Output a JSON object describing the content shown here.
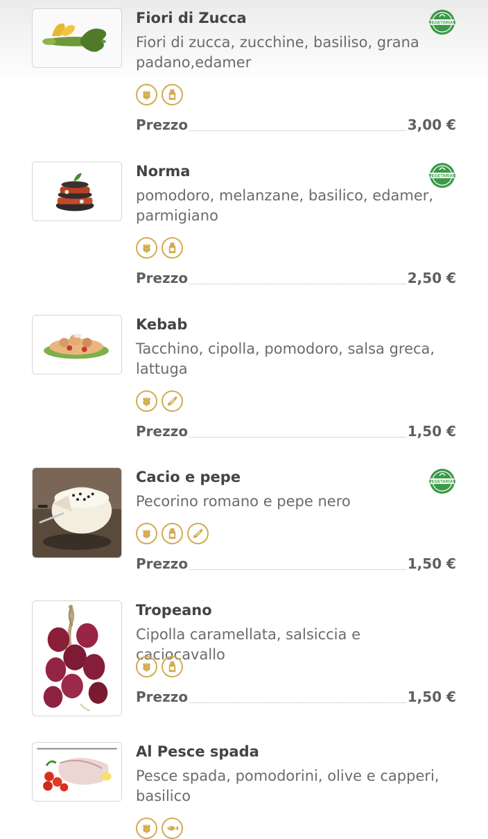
{
  "price_label": "Prezzo",
  "vegetarian_badge_text": "VEGETARIAN",
  "colors": {
    "accent_gold": "#d1ab52",
    "veg_green": "#3b9a47",
    "text_dark": "#444444"
  },
  "items": [
    {
      "name": "Fiori di Zucca",
      "description": "Fiori di zucca, zucchine, basiliso, grana padano,edamer",
      "price": "3,00 €",
      "vegetarian": true,
      "allergens": [
        "gluten-icon",
        "dairy-icon"
      ],
      "image": "zucchini-flower-image"
    },
    {
      "name": "Norma",
      "description": "pomodoro, melanzane, basilico, edamer, parmigiano",
      "price": "2,50 €",
      "vegetarian": true,
      "allergens": [
        "gluten-icon",
        "dairy-icon"
      ],
      "image": "eggplant-stack-image"
    },
    {
      "name": "Kebab",
      "description": "Tacchino, cipolla, pomodoro, salsa greca, lattuga",
      "price": "1,50 €",
      "vegetarian": false,
      "allergens": [
        "gluten-icon",
        "celery-icon"
      ],
      "image": "kebab-plate-image"
    },
    {
      "name": "Cacio e pepe",
      "description": "Pecorino romano e pepe nero",
      "price": "1,50 €",
      "vegetarian": true,
      "allergens": [
        "gluten-icon",
        "dairy-icon",
        "celery-icon"
      ],
      "image": "pecorino-cheese-image"
    },
    {
      "name": "Tropeano",
      "description": "Cipolla caramellata, salsiccia e caciocavallo",
      "price": "1,50 €",
      "vegetarian": false,
      "allergens": [
        "gluten-icon",
        "dairy-icon"
      ],
      "image": "red-onions-image"
    },
    {
      "name": "Al Pesce spada",
      "description": "Pesce spada, pomodorini, olive e capperi, basilico",
      "price": "",
      "vegetarian": false,
      "allergens": [
        "gluten-icon",
        "fish-icon"
      ],
      "image": "swordfish-image"
    }
  ]
}
